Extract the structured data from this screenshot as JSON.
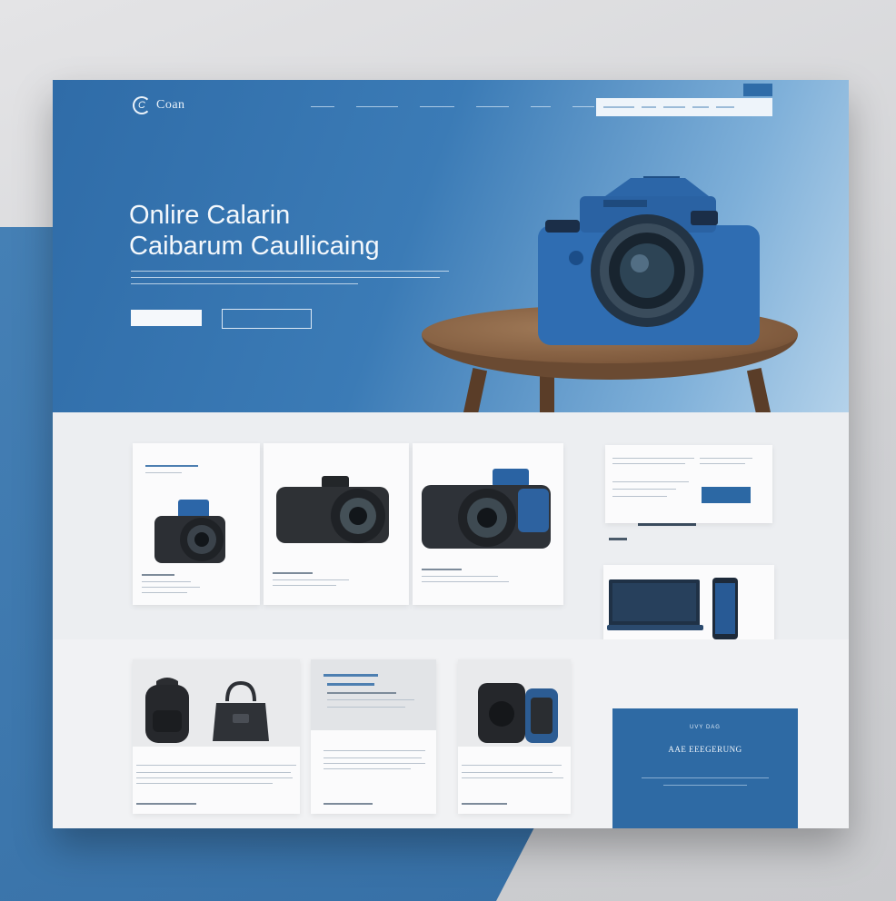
{
  "brand": {
    "logo_mark": "C",
    "name": "Coan"
  },
  "nav": {
    "items": [
      "",
      "",
      "",
      "",
      "",
      ""
    ],
    "search_placeholder": "",
    "flag": ""
  },
  "hero": {
    "title_line1": "Onlire Calarin",
    "title_line2": "Caibarum Caullicaing",
    "primary_button": "",
    "secondary_button": ""
  },
  "promo": {
    "kicker": "UVY  DAG",
    "title": "AAE EEEGERUNG"
  },
  "icons": [
    "logo-icon",
    "camera-icon",
    "bag-icon",
    "backpack-icon",
    "laptop-icon",
    "phone-icon"
  ],
  "colors": {
    "accent": "#2f6ca8",
    "hero_light": "#b4d2ea",
    "page_bg": "#f4f5f7"
  }
}
